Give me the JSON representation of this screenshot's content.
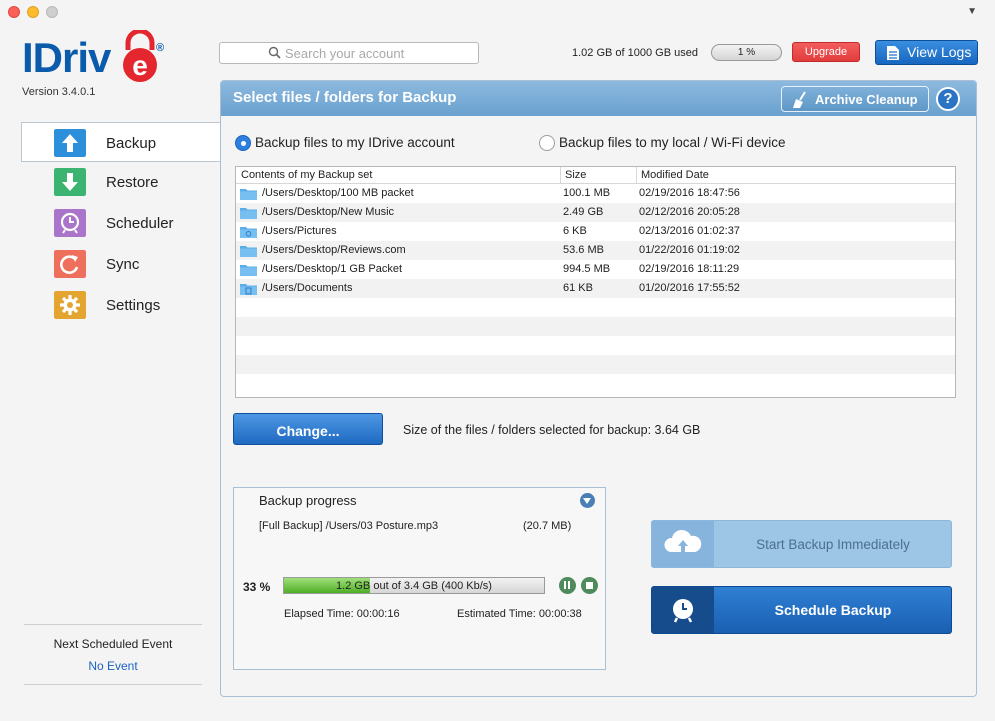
{
  "app": {
    "logo_text": "IDriv",
    "logo_reg": "®",
    "version": "Version 3.4.0.1"
  },
  "topbar": {
    "search_placeholder": "Search your account",
    "usage_text": "1.02 GB of 1000 GB used",
    "usage_percent_label": "1 %",
    "usage_fraction": 0.01,
    "upgrade_label": "Upgrade",
    "view_logs_label": "View Logs"
  },
  "sidebar": {
    "items": [
      {
        "label": "Backup",
        "icon": "upload-arrow-icon",
        "color": "#2c8fd9"
      },
      {
        "label": "Restore",
        "icon": "download-arrow-icon",
        "color": "#3bb371"
      },
      {
        "label": "Scheduler",
        "icon": "clock-icon",
        "color": "#a974c9"
      },
      {
        "label": "Sync",
        "icon": "sync-icon",
        "color": "#ee6f5c"
      },
      {
        "label": "Settings",
        "icon": "gear-icon",
        "color": "#e3a430"
      }
    ],
    "next_event_title": "Next Scheduled Event",
    "next_event_value": "No Event"
  },
  "panel": {
    "title": "Select files / folders for Backup",
    "archive_cleanup_label": "Archive Cleanup",
    "help_label": "?",
    "radio_idrive": "Backup files to my IDrive account",
    "radio_local": "Backup files to my local / Wi-Fi device",
    "radio_selected": "idrive",
    "table": {
      "headers": [
        "Contents of my Backup set",
        "Size",
        "Modified Date"
      ],
      "rows": [
        {
          "path": "/Users/Desktop/100 MB packet",
          "size": "100.1 MB",
          "date": "02/19/2016 18:47:56",
          "icon": "folder-icon"
        },
        {
          "path": "/Users/Desktop/New Music",
          "size": "2.49 GB",
          "date": "02/12/2016 20:05:28",
          "icon": "folder-icon"
        },
        {
          "path": "/Users/Pictures",
          "size": "6 KB",
          "date": "02/13/2016 01:02:37",
          "icon": "camera-folder-icon"
        },
        {
          "path": "/Users/Desktop/Reviews.com",
          "size": "53.6 MB",
          "date": "01/22/2016 01:19:02",
          "icon": "folder-icon"
        },
        {
          "path": "/Users/Desktop/1 GB Packet",
          "size": "994.5 MB",
          "date": "02/19/2016 18:11:29",
          "icon": "folder-icon"
        },
        {
          "path": "/Users/Documents",
          "size": "61 KB",
          "date": "01/20/2016 17:55:52",
          "icon": "document-folder-icon"
        }
      ]
    },
    "change_label": "Change...",
    "selected_size_text": "Size of the files / folders selected for backup: 3.64 GB"
  },
  "progress": {
    "title": "Backup progress",
    "current_file": "[Full Backup] /Users/03 Posture.mp3",
    "current_file_size": "(20.7 MB)",
    "percent_label": "33 %",
    "fraction": 0.33,
    "bar_text": "1.2 GB out of 3.4 GB (400 Kb/s)",
    "elapsed": "Elapsed Time: 00:00:16",
    "estimated": "Estimated Time: 00:00:38"
  },
  "actions": {
    "start_label": "Start Backup Immediately",
    "schedule_label": "Schedule Backup"
  },
  "colors": {
    "brand_blue": "#0a5bab",
    "brand_red": "#e4262e",
    "header_blue": "#7aaed6",
    "progress_green": "#5cb832"
  }
}
